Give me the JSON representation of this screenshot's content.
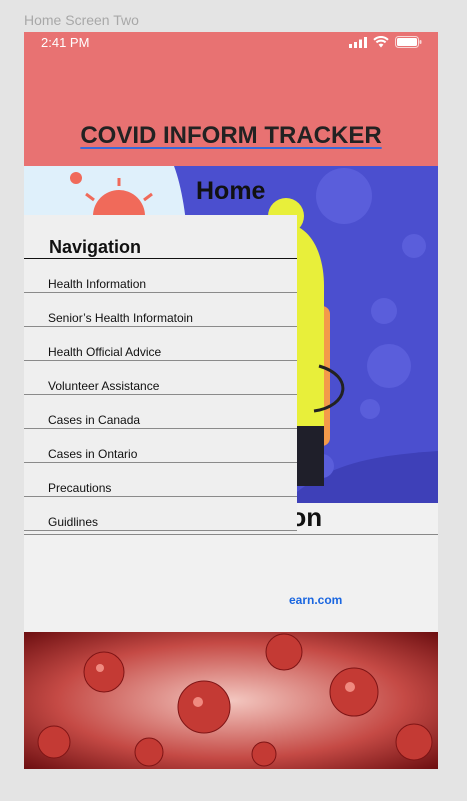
{
  "frame_label": "Home Screen Two",
  "status_bar": {
    "time": "2:41 PM"
  },
  "header": {
    "title": "COVID INFORM TRACKER"
  },
  "hero": {
    "title": "Home"
  },
  "navigation": {
    "title": "Navigation",
    "items": [
      {
        "label": "Health Information"
      },
      {
        "label": "Senior’s Health Informatoin"
      },
      {
        "label": "Health Official Advice"
      },
      {
        "label": "Volunteer Assistance"
      },
      {
        "label": "Cases in Canada"
      },
      {
        "label": "Cases in Ontario"
      },
      {
        "label": "Precautions"
      },
      {
        "label": "Guidlines"
      }
    ]
  },
  "info": {
    "heading_fragment": "ation",
    "link_fragment": "earn.com"
  },
  "colors": {
    "header_bg": "#e87272",
    "hero_blue": "#4b4fcf",
    "link": "#1a66e0"
  }
}
